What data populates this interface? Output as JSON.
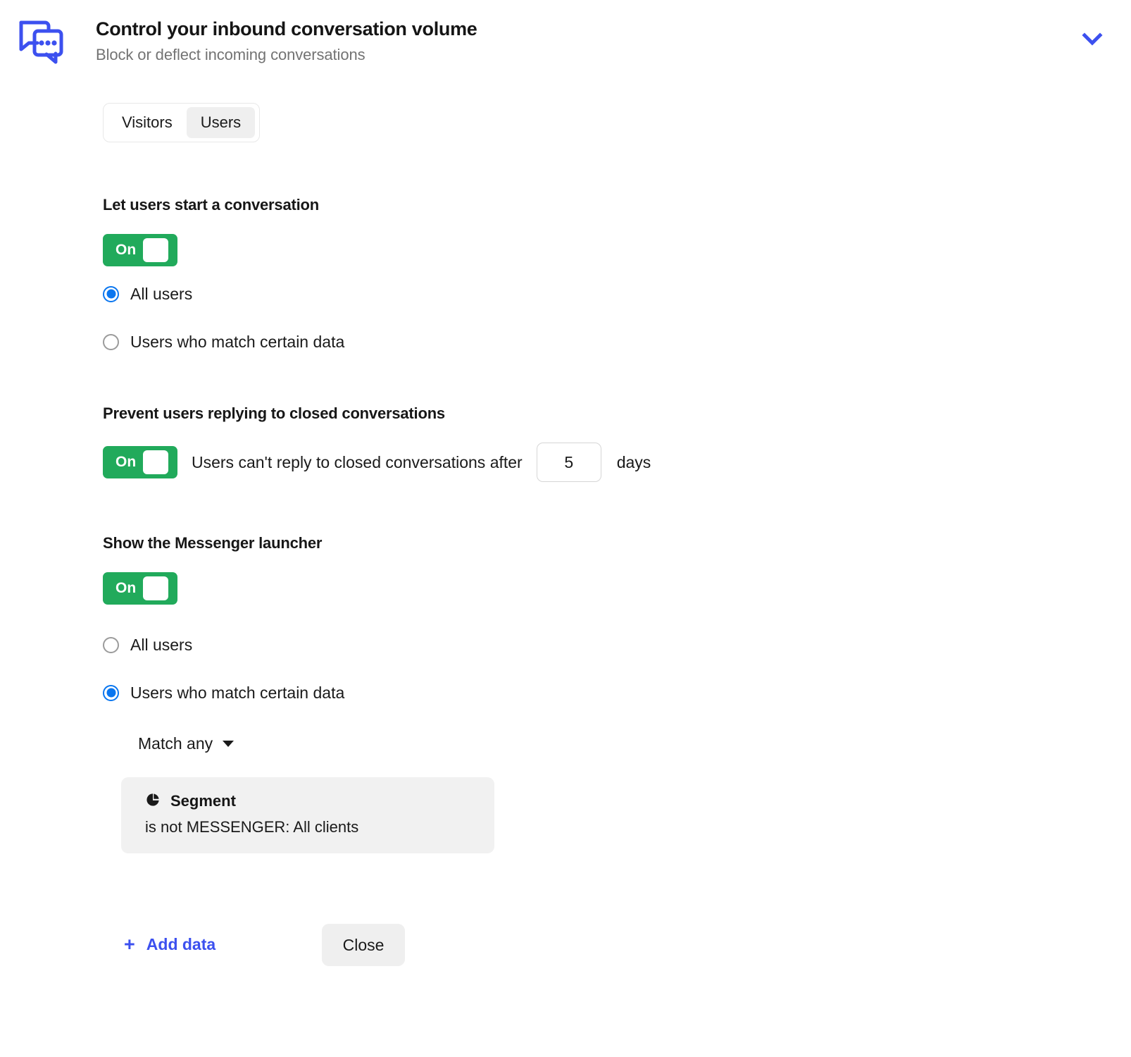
{
  "header": {
    "icon": "conversations-icon",
    "title": "Control your inbound conversation volume",
    "subtitle": "Block or deflect incoming conversations",
    "collapse_icon": "chevron-down-icon"
  },
  "tabs": [
    {
      "label": "Visitors",
      "selected": false
    },
    {
      "label": "Users",
      "selected": true
    }
  ],
  "sections": {
    "start_conversation": {
      "title": "Let users start a conversation",
      "toggle": {
        "label": "On",
        "state": "on",
        "color": "#21aa5b"
      },
      "options": [
        {
          "label": "All users",
          "selected": true
        },
        {
          "label": "Users who match certain data",
          "selected": false
        }
      ]
    },
    "prevent_reply": {
      "title": "Prevent users replying to closed conversations",
      "toggle": {
        "label": "On",
        "state": "on",
        "color": "#21aa5b"
      },
      "sentence": "Users can't reply to closed conversations after",
      "days_value": "5",
      "days_unit": "days"
    },
    "show_launcher": {
      "title": "Show the Messenger launcher",
      "toggle": {
        "label": "On",
        "state": "on",
        "color": "#21aa5b"
      },
      "options": [
        {
          "label": "All users",
          "selected": false
        },
        {
          "label": "Users who match certain data",
          "selected": true
        }
      ],
      "match_rule": {
        "label": "Match any",
        "caret": "caret-down-icon"
      },
      "rules": [
        {
          "icon": "pie-chart-icon",
          "attribute": "Segment",
          "condition": "is not MESSENGER: All clients"
        }
      ],
      "add_data": {
        "plus": "+",
        "label": "Add data",
        "color": "#3c50ef"
      }
    }
  },
  "footer": {
    "close_label": "Close"
  }
}
